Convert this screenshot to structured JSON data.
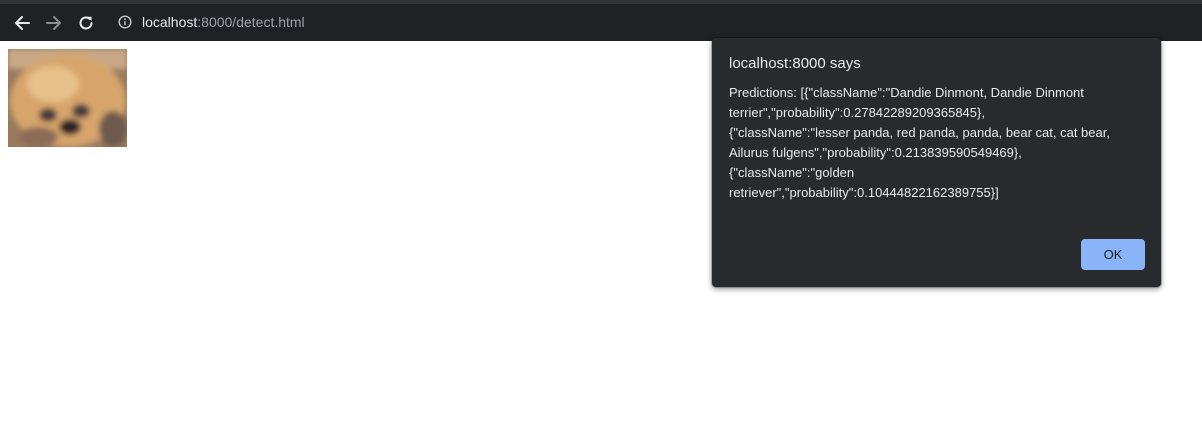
{
  "browser": {
    "url_host": "localhost",
    "url_rest": ":8000/detect.html",
    "icons": {
      "back": "arrow-left-icon",
      "forward": "arrow-right-icon",
      "reload": "reload-icon",
      "info": "info-icon"
    }
  },
  "page": {
    "image": "blurry-dog-photo"
  },
  "dialog": {
    "title": "localhost:8000 says",
    "message_lines": [
      "Predictions: [{\"className\":\"Dandie Dinmont, Dandie Dinmont",
      "terrier\",\"probability\":0.27842289209365845},",
      "{\"className\":\"lesser panda, red panda, panda, bear cat, cat bear,",
      "Ailurus fulgens\",\"probability\":0.213839590549469},",
      "{\"className\":\"golden",
      "retriever\",\"probability\":0.10444822162389755}]"
    ],
    "ok_label": "OK"
  },
  "colors": {
    "toolbar": "#202124",
    "dialog_bg": "#292a2d",
    "ok_button": "#8ab4f8"
  }
}
